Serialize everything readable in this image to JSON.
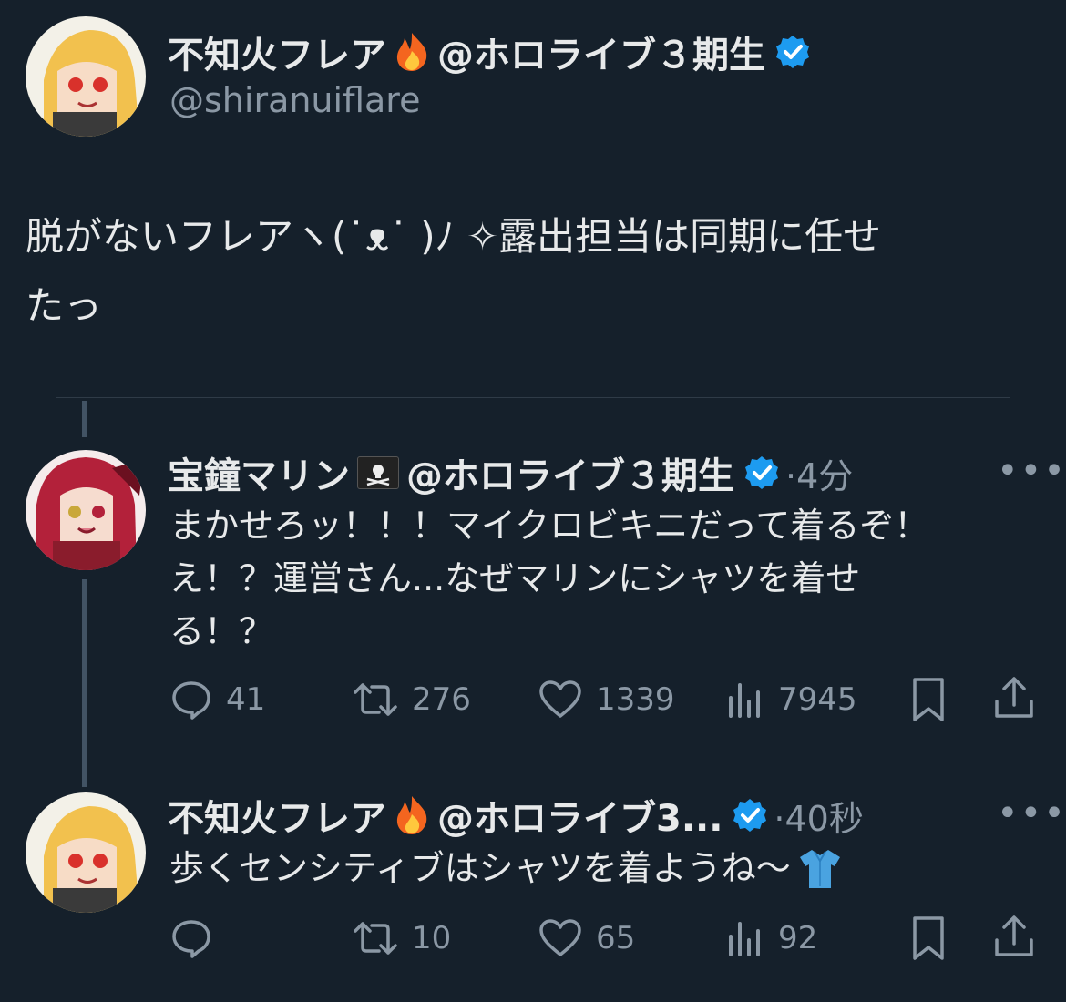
{
  "main_tweet": {
    "author_name": "不知火フレア",
    "author_suffix": "@ホロライブ３期生",
    "handle": "@shiranuiflare",
    "text_line1": "脱がないフレアヽ(˙ᴥ˙ )ﾉ ✧露出担当は同期に任せ",
    "text_line2": "たっ"
  },
  "reply1": {
    "author_name": "宝鐘マリン",
    "author_suffix": "@ホロライブ３期生",
    "time": "·4分",
    "text": [
      "まかせろッ！！！マイクロビキニだって着るぞ！",
      "え！？運営さん...なぜマリンにシャツを着せ",
      "る！？"
    ],
    "stats": {
      "replies": "41",
      "retweets": "276",
      "likes": "1339",
      "views": "7945"
    }
  },
  "reply2": {
    "author_name": "不知火フレア",
    "author_suffix": "@ホロライブ3...",
    "time": "·40秒",
    "text": "歩くセンシティブはシャツを着ようね～",
    "stats": {
      "replies": "",
      "retweets": "10",
      "likes": "65",
      "views": "92"
    }
  },
  "more_label": "•••",
  "icons": [
    "fire-emoji",
    "verified-badge-icon",
    "pirate-flag-emoji",
    "shirt-emoji",
    "reply-icon",
    "retweet-icon",
    "like-icon",
    "views-icon",
    "bookmark-icon",
    "share-icon"
  ],
  "colors": {
    "background": "#15202b",
    "verified": "#1d9bf0",
    "muted": "#8b98a5",
    "text": "#e7e9ea"
  }
}
